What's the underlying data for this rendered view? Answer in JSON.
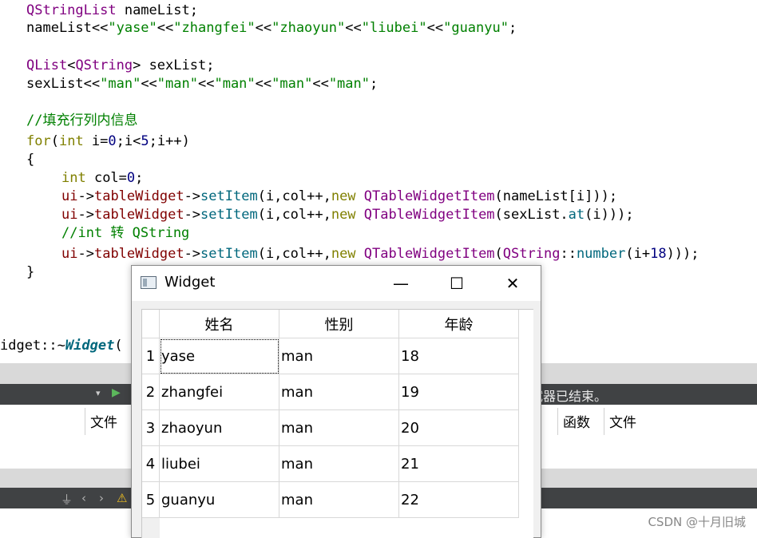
{
  "code": {
    "l1": [
      "QStringList",
      " nameList;"
    ],
    "l2": [
      "nameList<<",
      "\"yase\"",
      "<<",
      "\"zhangfei\"",
      "<<",
      "\"zhaoyun\"",
      "<<",
      "\"liubei\"",
      "<<",
      "\"guanyu\"",
      ";"
    ],
    "l3": [
      "QList",
      "<",
      "QString",
      "> sexList;"
    ],
    "l4": [
      "sexList<<",
      "\"man\"",
      "<<",
      "\"man\"",
      "<<",
      "\"man\"",
      "<<",
      "\"man\"",
      "<<",
      "\"man\"",
      ";"
    ],
    "l5": "//填充行列内信息",
    "l6": [
      "for",
      "(",
      "int",
      " i=",
      "0",
      ";i<",
      "5",
      ";i++)"
    ],
    "l7": "{",
    "l8": [
      "int",
      " col=",
      "0",
      ";"
    ],
    "l9": [
      "ui",
      "->",
      "tableWidget",
      "->",
      "setItem",
      "(i,col++,",
      "new ",
      "QTableWidgetItem",
      "(nameList[i]));"
    ],
    "l10": [
      "ui",
      "->",
      "tableWidget",
      "->",
      "setItem",
      "(i,col++,",
      "new ",
      "QTableWidgetItem",
      "(sexList.",
      "at",
      "(i)));"
    ],
    "l11": "//int 转 QString",
    "l12": [
      "ui",
      "->",
      "tableWidget",
      "->",
      "setItem",
      "(i,col++,",
      "new ",
      "QTableWidgetItem",
      "(",
      "QString",
      "::",
      "number",
      "(i+",
      "18",
      ")));"
    ],
    "l13": "}",
    "l14": [
      "idget::~",
      "Widget",
      "("
    ]
  },
  "ide": {
    "output_message": "试器已结束。",
    "panel_headers": [
      "文件",
      "函数",
      "文件"
    ]
  },
  "window": {
    "title": "Widget",
    "minimize_glyph": "—",
    "maximize_glyph": "☐",
    "close_glyph": "✕"
  },
  "table": {
    "columns": [
      "姓名",
      "性别",
      "年龄"
    ],
    "row_headers": [
      "1",
      "2",
      "3",
      "4",
      "5"
    ],
    "rows": [
      [
        "yase",
        "man",
        "18"
      ],
      [
        "zhangfei",
        "man",
        "19"
      ],
      [
        "zhaoyun",
        "man",
        "20"
      ],
      [
        "liubei",
        "man",
        "21"
      ],
      [
        "guanyu",
        "man",
        "22"
      ]
    ]
  },
  "watermark": "CSDN @十月旧城"
}
